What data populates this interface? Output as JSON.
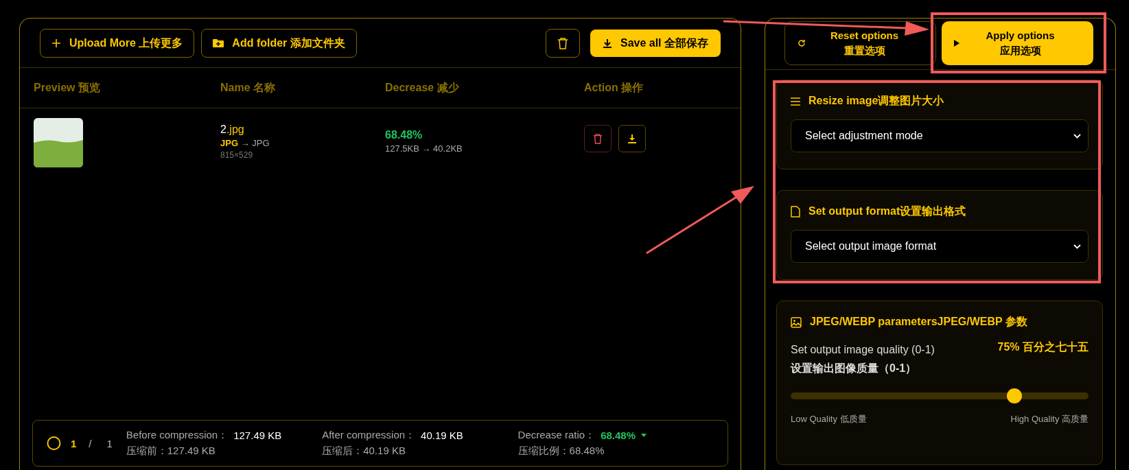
{
  "toolbar": {
    "buttons": [
      {
        "kind": "upload",
        "label": "Upload More 上传更多"
      },
      {
        "kind": "folder",
        "label": "Add folder 添加文件夹"
      }
    ],
    "save_all": "Save all 全部保存"
  },
  "table": {
    "columns": [
      "Preview 预览",
      "Name 名称",
      "Decrease 减少",
      "Action 操作"
    ],
    "rows": [
      {
        "name": "2",
        "extension": ".jpg",
        "format_from": "JPG",
        "format_separator": "→",
        "format_to": "JPG",
        "dimensions": "815×529",
        "decrease": "68.48%",
        "sizes": "127.5KB → 40.2KB"
      }
    ]
  },
  "summary": {
    "current": "1",
    "separator": "/",
    "total": "1",
    "stats": [
      {
        "label": "Before compression：",
        "value": "127.49 KB",
        "line_zh": "压缩前：127.49 KB",
        "highlight": false
      },
      {
        "label": "After compression：",
        "value": "40.19 KB",
        "line_zh": "压缩后：40.19 KB",
        "highlight": false
      },
      {
        "label": "Decrease ratio：",
        "value": "68.48%",
        "line_zh": "压缩比例：68.48%",
        "highlight": true
      }
    ]
  },
  "options": {
    "reset": {
      "line_1": "Reset options",
      "line_2": "重置选项"
    },
    "apply": {
      "line_1": "Apply options",
      "line_2": "应用选项"
    },
    "cards": [
      {
        "kind": "select",
        "title": "Resize image调整图片大小",
        "placeholder": "Select adjustment mode"
      },
      {
        "kind": "select",
        "title": "Set output format设置输出格式",
        "placeholder": "Select output image format"
      },
      {
        "kind": "slider",
        "title": "JPEG/WEBP parametersJPEG/WEBP 参数",
        "label": "Set output image quality (0-1)",
        "label_zh": "设置输出图像质量（0-1）",
        "reading": "75% 百分之七十五",
        "level": 0.75,
        "low_label": "Low Quality 低质量",
        "high_label": "High Quality 高质量"
      }
    ]
  }
}
